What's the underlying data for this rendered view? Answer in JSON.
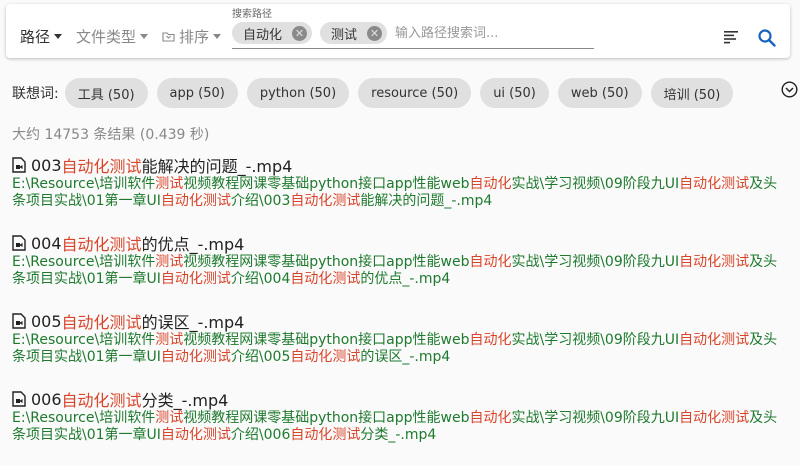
{
  "toolbar": {
    "path_menu": "路径",
    "filetype_menu": "文件类型",
    "sort_menu": "排序",
    "search_label": "搜索路径",
    "chips": [
      "自动化",
      "测试"
    ],
    "placeholder": "输入路径搜索词...",
    "icons": [
      "caret-down-icon",
      "sort-icon",
      "close-icon",
      "list-icon",
      "search-icon"
    ]
  },
  "suggestions": {
    "label": "联想词:",
    "items": [
      "工具 (50)",
      "app (50)",
      "python (50)",
      "resource (50)",
      "ui (50)",
      "web (50)",
      "培训 (50)"
    ]
  },
  "summary": "大约 14753 条结果 (0.439 秒)",
  "colors": {
    "highlight": "#d9452a",
    "path": "#1e7a2e",
    "accent": "#1565c0"
  },
  "results": [
    {
      "title": [
        {
          "t": "003",
          "h": false
        },
        {
          "t": "自动化测试",
          "h": true
        },
        {
          "t": "能解决的问题_-.mp4",
          "h": false
        }
      ],
      "path": [
        {
          "t": "E:\\Resource\\培训软件",
          "h": false
        },
        {
          "t": "测试",
          "h": true
        },
        {
          "t": "视频教程网课零基础python接口app性能web",
          "h": false
        },
        {
          "t": "自动化",
          "h": true
        },
        {
          "t": "实战\\学习视频\\09阶段九UI",
          "h": false
        },
        {
          "t": "自动化测试",
          "h": true
        },
        {
          "t": "及头条项目实战\\01第一章UI",
          "h": false
        },
        {
          "t": "自动化测试",
          "h": true
        },
        {
          "t": "介绍\\003",
          "h": false
        },
        {
          "t": "自动化测试",
          "h": true
        },
        {
          "t": "能解决的问题_-.mp4",
          "h": false
        }
      ]
    },
    {
      "title": [
        {
          "t": "004",
          "h": false
        },
        {
          "t": "自动化测试",
          "h": true
        },
        {
          "t": "的优点_-.mp4",
          "h": false
        }
      ],
      "path": [
        {
          "t": "E:\\Resource\\培训软件",
          "h": false
        },
        {
          "t": "测试",
          "h": true
        },
        {
          "t": "视频教程网课零基础python接口app性能web",
          "h": false
        },
        {
          "t": "自动化",
          "h": true
        },
        {
          "t": "实战\\学习视频\\09阶段九UI",
          "h": false
        },
        {
          "t": "自动化测试",
          "h": true
        },
        {
          "t": "及头条项目实战\\01第一章UI",
          "h": false
        },
        {
          "t": "自动化测试",
          "h": true
        },
        {
          "t": "介绍\\004",
          "h": false
        },
        {
          "t": "自动化测试",
          "h": true
        },
        {
          "t": "的优点_-.mp4",
          "h": false
        }
      ]
    },
    {
      "title": [
        {
          "t": "005",
          "h": false
        },
        {
          "t": "自动化测试",
          "h": true
        },
        {
          "t": "的误区_-.mp4",
          "h": false
        }
      ],
      "path": [
        {
          "t": "E:\\Resource\\培训软件",
          "h": false
        },
        {
          "t": "测试",
          "h": true
        },
        {
          "t": "视频教程网课零基础python接口app性能web",
          "h": false
        },
        {
          "t": "自动化",
          "h": true
        },
        {
          "t": "实战\\学习视频\\09阶段九UI",
          "h": false
        },
        {
          "t": "自动化测试",
          "h": true
        },
        {
          "t": "及头条项目实战\\01第一章UI",
          "h": false
        },
        {
          "t": "自动化测试",
          "h": true
        },
        {
          "t": "介绍\\005",
          "h": false
        },
        {
          "t": "自动化测试",
          "h": true
        },
        {
          "t": "的误区_-.mp4",
          "h": false
        }
      ]
    },
    {
      "title": [
        {
          "t": "006",
          "h": false
        },
        {
          "t": "自动化测试",
          "h": true
        },
        {
          "t": "分类_-.mp4",
          "h": false
        }
      ],
      "path": [
        {
          "t": "E:\\Resource\\培训软件",
          "h": false
        },
        {
          "t": "测试",
          "h": true
        },
        {
          "t": "视频教程网课零基础python接口app性能web",
          "h": false
        },
        {
          "t": "自动化",
          "h": true
        },
        {
          "t": "实战\\学习视频\\09阶段九UI",
          "h": false
        },
        {
          "t": "自动化测试",
          "h": true
        },
        {
          "t": "及头条项目实战\\01第一章UI",
          "h": false
        },
        {
          "t": "自动化测试",
          "h": true
        },
        {
          "t": "介绍\\006",
          "h": false
        },
        {
          "t": "自动化测试",
          "h": true
        },
        {
          "t": "分类_-.mp4",
          "h": false
        }
      ]
    }
  ]
}
